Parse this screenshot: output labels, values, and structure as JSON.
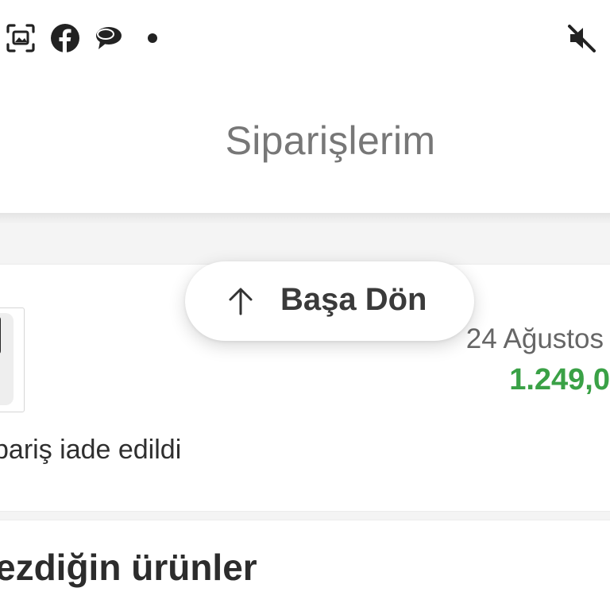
{
  "status_bar": {
    "icons": [
      "screenshot-icon",
      "facebook-icon",
      "chat-bubbles-icon",
      "notification-dot-icon",
      "mute-icon"
    ]
  },
  "header": {
    "title": "Siparişlerim"
  },
  "order": {
    "date": "24 Ağustos",
    "price": "1.249,0",
    "status": "pariş iade edildi",
    "accent_color": "#3aa146"
  },
  "section": {
    "title": "ezdiğin ürünler"
  },
  "back_to_top": {
    "label": "Başa Dön"
  }
}
